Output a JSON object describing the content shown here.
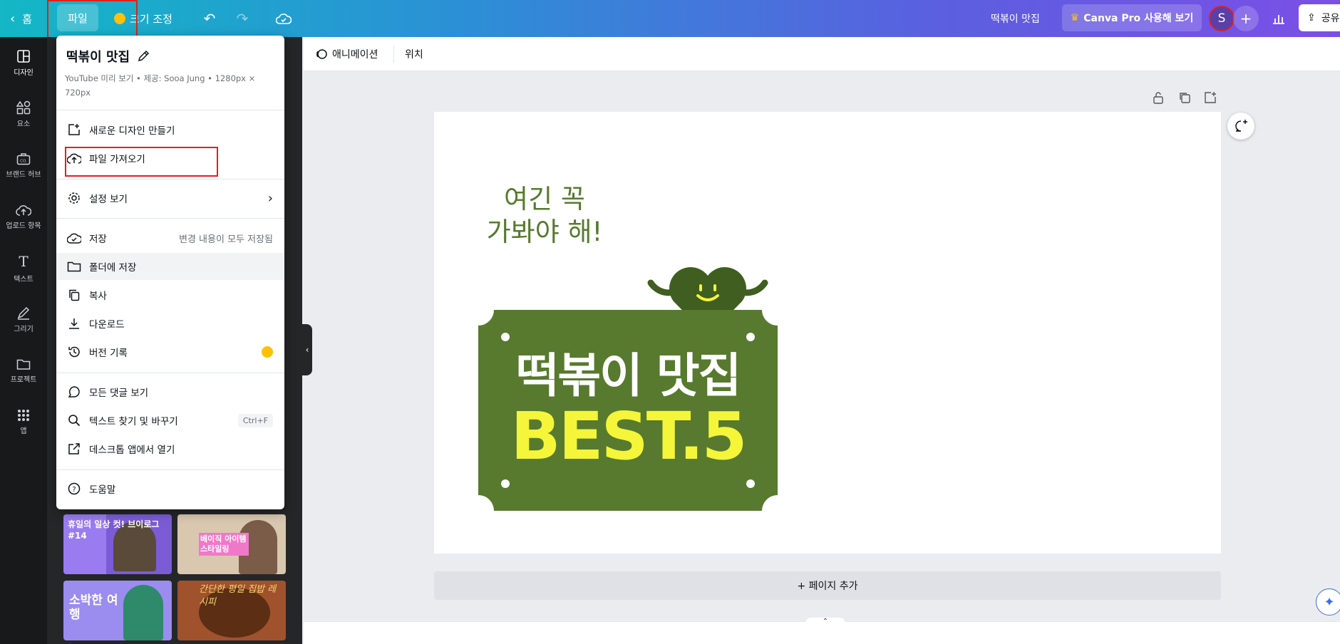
{
  "topbar": {
    "home_label": "홈",
    "file_label": "파일",
    "resize_label": "크기 조정",
    "doc_title": "떡볶이 맛집",
    "pro_label": "Canva Pro 사용해 보기",
    "avatar_letter": "S",
    "share_label": "공유"
  },
  "rail": {
    "items": [
      {
        "label": "디자인",
        "icon": "design-icon"
      },
      {
        "label": "요소",
        "icon": "elements-icon"
      },
      {
        "label": "브랜드 허브",
        "icon": "brand-hub-icon"
      },
      {
        "label": "업로드 항목",
        "icon": "upload-icon"
      },
      {
        "label": "텍스트",
        "icon": "text-icon"
      },
      {
        "label": "그리기",
        "icon": "draw-icon"
      },
      {
        "label": "프로젝트",
        "icon": "folder-icon"
      },
      {
        "label": "앱",
        "icon": "apps-icon"
      }
    ]
  },
  "menu": {
    "title": "떡볶이 맛집",
    "subtitle": "YouTube 미리 보기 • 제공: Sooa Jung • 1280px × 720px",
    "items": [
      {
        "label": "새로운 디자인 만들기",
        "icon": "new-design-icon"
      },
      {
        "label": "파일 가져오기",
        "icon": "cloud-upload-icon"
      },
      {
        "label": "설정 보기",
        "icon": "settings-icon"
      },
      {
        "label": "저장",
        "icon": "cloud-check-icon",
        "right": "변경 내용이 모두 저장됨"
      },
      {
        "label": "폴더에 저장",
        "icon": "folder-icon"
      },
      {
        "label": "복사",
        "icon": "copy-icon"
      },
      {
        "label": "다운로드",
        "icon": "download-icon"
      },
      {
        "label": "버전 기록",
        "icon": "history-icon"
      },
      {
        "label": "모든 댓글 보기",
        "icon": "comment-icon"
      },
      {
        "label": "텍스트 찾기 및 바꾸기",
        "icon": "search-icon",
        "shortcut": "Ctrl+F"
      },
      {
        "label": "데스크톱 앱에서 열기",
        "icon": "external-icon"
      },
      {
        "label": "도움말",
        "icon": "help-icon"
      }
    ]
  },
  "thumbnails": [
    {
      "text": "휴일의 일상 컷! 브이로그 #14",
      "bg": "#7b5cd6"
    },
    {
      "text": "베이직 아이템 스타일링",
      "bg": "#d9c7b0"
    },
    {
      "text": "소박한 여행",
      "bg": "#9b8cf0"
    },
    {
      "text": "간단한 평일 집밥 레시피",
      "bg": "#a0522d"
    }
  ],
  "context_bar": {
    "animate_label": "애니메이션",
    "position_label": "위치"
  },
  "design": {
    "tagline_line1": "여긴 꼭",
    "tagline_line2": "가봐야 해!",
    "headline": "떡볶이 맛집",
    "best": "BEST.5",
    "green": "#577a2e",
    "dark_green": "#3f5e1f",
    "yellow": "#f5f53a"
  },
  "add_page_label": "+ 페이지 추가"
}
